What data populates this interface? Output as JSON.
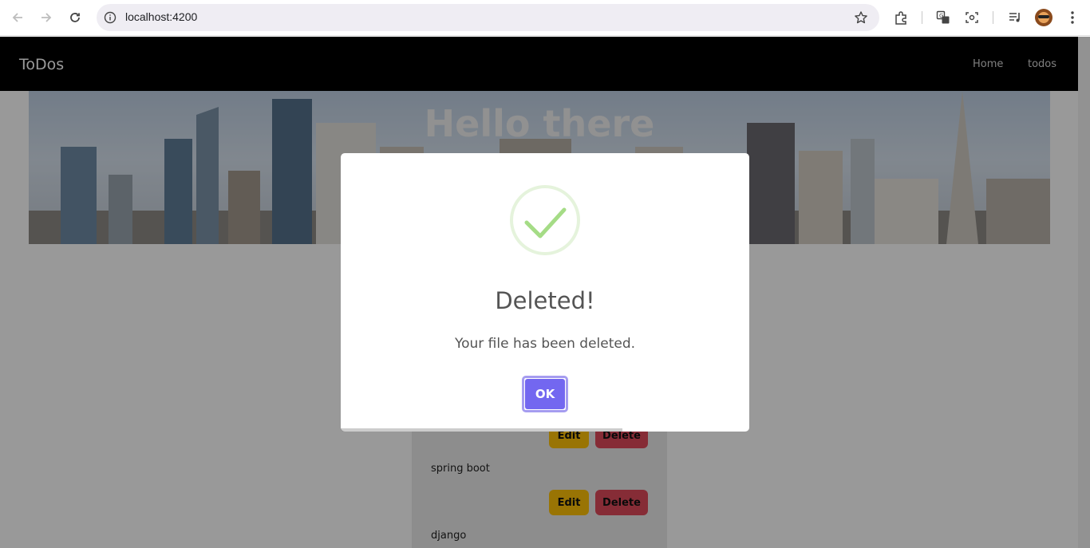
{
  "browser": {
    "url": "localhost:4200"
  },
  "navbar": {
    "brand": "ToDos",
    "links": [
      "Home",
      "todos"
    ]
  },
  "hero": {
    "title": "Hello there"
  },
  "todos": {
    "items": [
      "spring boot",
      "django"
    ],
    "edit_label": "Edit",
    "delete_label": "Delete"
  },
  "dialog": {
    "title": "Deleted!",
    "text": "Your file has been deleted.",
    "confirm_label": "OK",
    "timer_progress": 0.69,
    "icon": "success-check-icon"
  },
  "colors": {
    "navbar_bg": "#000000",
    "confirm_button": "#7367f0",
    "edit_button": "#ffc107",
    "delete_button": "#e04a5a",
    "success_icon": "#a5dc86"
  }
}
